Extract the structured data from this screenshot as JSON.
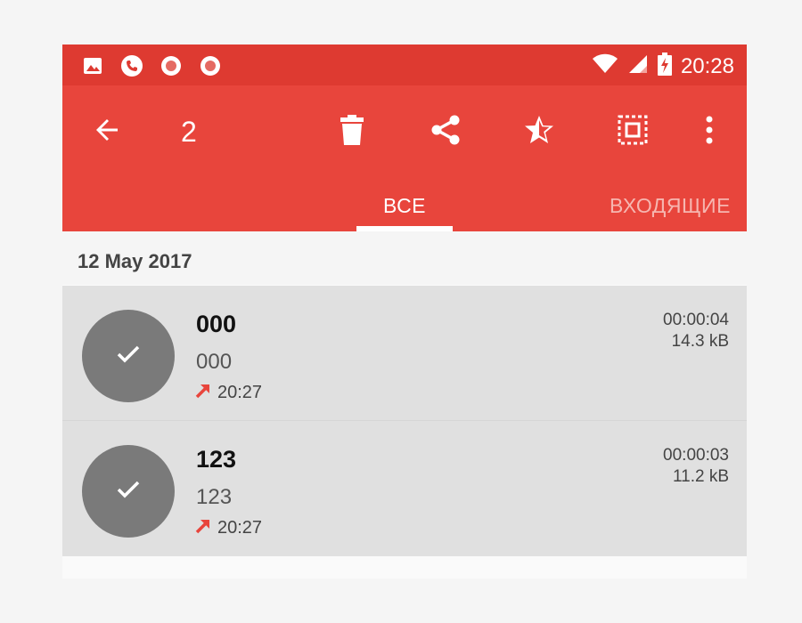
{
  "status_bar": {
    "time": "20:28",
    "left_icons": [
      "image-icon",
      "phone-icon",
      "record-icon",
      "record-icon"
    ],
    "right_icons": [
      "wifi-icon",
      "signal-icon",
      "battery-charging-icon"
    ]
  },
  "toolbar": {
    "selected_count": "2",
    "back_icon": "arrow-left-icon",
    "actions": [
      "delete-icon",
      "share-icon",
      "star-icon",
      "select-all-icon",
      "more-vert-icon"
    ]
  },
  "tabs": [
    {
      "label": "ВСЕ",
      "active": true
    },
    {
      "label": "ВХОДЯЩИЕ",
      "active": false
    }
  ],
  "date_header": "12 May 2017",
  "recordings": [
    {
      "title": "000",
      "number": "000",
      "time": "20:27",
      "duration": "00:00:04",
      "size": "14.3 kB",
      "direction": "outgoing"
    },
    {
      "title": "123",
      "number": "123",
      "time": "20:27",
      "duration": "00:00:03",
      "size": "11.2 kB",
      "direction": "outgoing"
    }
  ],
  "colors": {
    "app_bar": "#e8453c",
    "status_bar": "#de3a31",
    "selected_row": "#e0e0e0",
    "avatar": "#7a7a7a",
    "outgoing_arrow": "#e8453c"
  }
}
